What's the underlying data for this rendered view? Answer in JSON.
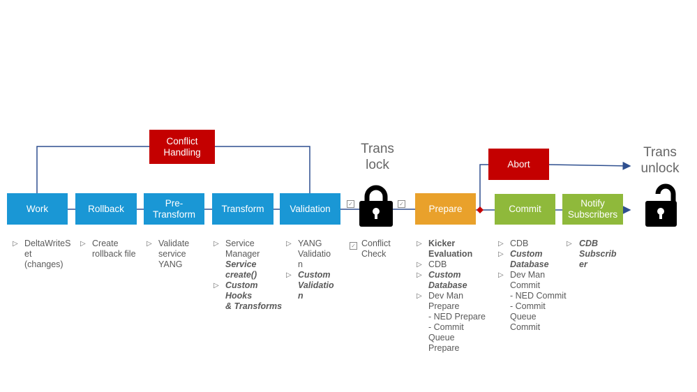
{
  "colors": {
    "stage_blue": "#1a97d5",
    "conflict_red": "#c40000",
    "prepare_orange": "#e9a12b",
    "commit_green": "#8fb93b",
    "line": "#2e4f8f"
  },
  "stages": {
    "work": "Work",
    "rollback": "Rollback",
    "pretransform": "Pre-\nTransform",
    "transform": "Transform",
    "validation": "Validation",
    "prepare": "Prepare",
    "commit": "Commit",
    "notify": "Notify\nSubscribers",
    "abort": "Abort",
    "conflict": "Conflict\nHandling"
  },
  "labels": {
    "trans_lock": "Trans\nlock",
    "trans_unlock": "Trans\nunlock"
  },
  "icons": {
    "lock": "lock-icon",
    "unlock": "unlock-icon",
    "bullet": "triangle-right-icon",
    "check": "checkbox-icon"
  },
  "notes": {
    "work": [
      "DeltaWriteS\net\n(changes)"
    ],
    "rollback": [
      "Create\nrollback file"
    ],
    "pretransform": [
      "Validate\nservice\nYANG"
    ],
    "transform_a": "Service\nManager",
    "transform_b": "Service\ncreate()",
    "transform_c": "Custom\nHooks\n& Transforms",
    "validation_a": "YANG\nValidatio\nn",
    "validation_b": "Custom\nValidatio\nn",
    "conflict_check": "Conflict\nCheck",
    "prepare_a": "Kicker\nEvaluation",
    "prepare_b": "CDB",
    "prepare_c": "Custom\nDatabase",
    "prepare_d": "Dev Man\nPrepare\n- NED Prepare\n- Commit\nQueue\n  Prepare",
    "commit_a": "CDB",
    "commit_b": "Custom\nDatabase",
    "commit_c": "Dev Man Commit\n- NED Commit\n- Commit Queue\nCommit",
    "notify_a": "CDB\nSubscrib\ner"
  }
}
